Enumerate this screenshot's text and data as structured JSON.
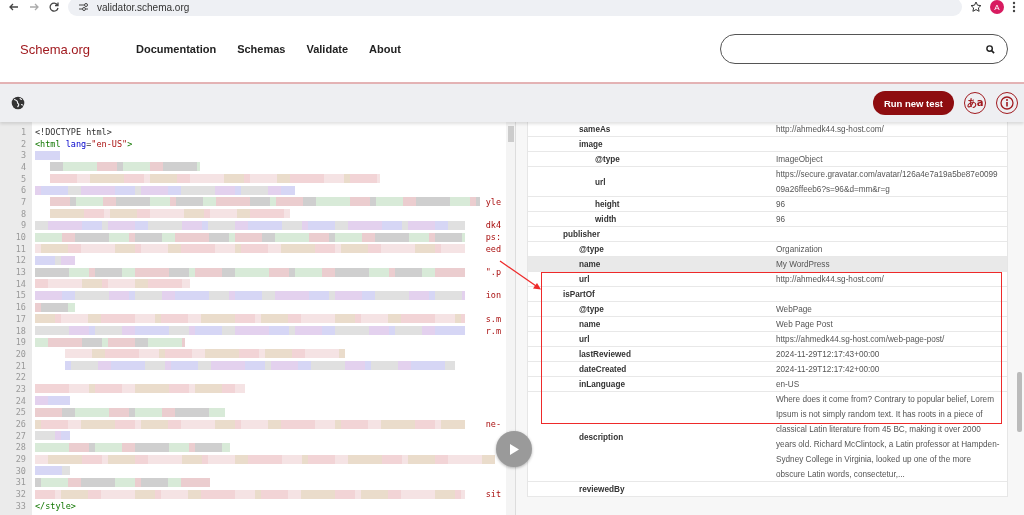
{
  "browser": {
    "url": "validator.schema.org",
    "avatar": "A"
  },
  "header": {
    "logo": "Schema.org",
    "nav": [
      {
        "label": "Documentation"
      },
      {
        "label": "Schemas"
      },
      {
        "label": "Validate"
      },
      {
        "label": "About"
      }
    ]
  },
  "toolbar": {
    "run_button": "Run new test",
    "language_button": "あa"
  },
  "editor": {
    "lines": [
      {
        "number": "1",
        "kind": "code",
        "tokens": [
          {
            "kind": "plain",
            "text": "<!DOCTYPE html>"
          }
        ]
      },
      {
        "number": "2",
        "kind": "code",
        "tokens": [
          {
            "kind": "tag",
            "text": "<html"
          },
          {
            "kind": "attr",
            "text": " lang"
          },
          {
            "kind": "plain",
            "text": "="
          },
          {
            "kind": "string",
            "text": "\"en-US\""
          },
          {
            "kind": "tag",
            "text": ">"
          }
        ]
      },
      {
        "number": "3",
        "kind": "blurred"
      },
      {
        "number": "4",
        "kind": "blurred"
      },
      {
        "number": "5",
        "kind": "blurred"
      },
      {
        "number": "6",
        "kind": "blurred"
      },
      {
        "number": "7",
        "kind": "blurred",
        "tail": "yle"
      },
      {
        "number": "8",
        "kind": "blurred"
      },
      {
        "number": "9",
        "kind": "blurred",
        "tail": "dk4"
      },
      {
        "number": "10",
        "kind": "blurred",
        "tail": "ps:"
      },
      {
        "number": "11",
        "kind": "blurred",
        "tail": "eed"
      },
      {
        "number": "12",
        "kind": "blurred"
      },
      {
        "number": "13",
        "kind": "blurred",
        "tail": "\".p"
      },
      {
        "number": "14",
        "kind": "blurred"
      },
      {
        "number": "15",
        "kind": "blurred",
        "tail": "ion"
      },
      {
        "number": "16",
        "kind": "blurred"
      },
      {
        "number": "17",
        "kind": "blurred",
        "tail": "s.m"
      },
      {
        "number": "18",
        "kind": "blurred",
        "tail": "r.m"
      },
      {
        "number": "19",
        "kind": "blurred"
      },
      {
        "number": "20",
        "kind": "blurred"
      },
      {
        "number": "21",
        "kind": "blurred"
      },
      {
        "number": "22",
        "kind": "blurred"
      },
      {
        "number": "23",
        "kind": "blurred"
      },
      {
        "number": "24",
        "kind": "blurred"
      },
      {
        "number": "25",
        "kind": "blurred"
      },
      {
        "number": "26",
        "kind": "blurred",
        "tail": "ne-"
      },
      {
        "number": "27",
        "kind": "blurred"
      },
      {
        "number": "28",
        "kind": "blurred"
      },
      {
        "number": "29",
        "kind": "blurred"
      },
      {
        "number": "30",
        "kind": "blurred"
      },
      {
        "number": "31",
        "kind": "blurred"
      },
      {
        "number": "32",
        "kind": "blurred",
        "tail": "sit"
      },
      {
        "number": "33",
        "kind": "code",
        "tokens": [
          {
            "kind": "tag",
            "text": "</style>"
          }
        ]
      }
    ]
  },
  "results": {
    "properties": [
      {
        "children": [
          {
            "key": "sameAs",
            "value": "http://ahmedk44.sg-host.com/",
            "selected": false
          },
          {
            "key": "image",
            "selected": false,
            "children": [
              {
                "key": "@type",
                "value": "ImageObject",
                "selected": false
              },
              {
                "key": "url",
                "value": "https://secure.gravatar.com/avatar/126a4e7a19a5be87e009909a26ffeeb6?s=96&d=mm&r=g",
                "selected": false
              },
              {
                "key": "height",
                "value": "96",
                "selected": false
              },
              {
                "key": "width",
                "value": "96",
                "selected": false
              }
            ]
          }
        ]
      },
      {
        "key": "publisher",
        "selected": false,
        "children": [
          {
            "key": "@type",
            "value": "Organization",
            "selected": false
          },
          {
            "key": "name",
            "value": "My WordPress",
            "selected": true
          },
          {
            "key": "url",
            "value": "http://ahmedk44.sg-host.com/",
            "selected": false
          }
        ]
      },
      {
        "key": "isPartOf",
        "selected": false,
        "children": [
          {
            "key": "@type",
            "value": "WebPage",
            "selected": false
          },
          {
            "key": "name",
            "value": "Web Page Post",
            "selected": false
          },
          {
            "key": "url",
            "value": "https://ahmedk44.sg-host.com/web-page-post/",
            "selected": false
          },
          {
            "key": "lastReviewed",
            "value": "2024-11-29T12:17:43+00:00",
            "selected": false
          },
          {
            "key": "dateCreated",
            "value": "2024-11-29T12:17:42+00:00",
            "selected": false
          },
          {
            "key": "inLanguage",
            "value": "en-US",
            "selected": false
          },
          {
            "key": "description",
            "value": "Where does it come from? Contrary to popular belief, Lorem Ipsum is not simply random text. It has roots in a piece of classical Latin literature from 45 BC, making it over 2000 years old. Richard McClintock, a Latin professor at Hampden-Sydney College in Virginia, looked up one of the more obscure Latin words, consectetur,...",
            "selected": false
          },
          {
            "key": "reviewedBy",
            "selected": false
          }
        ]
      }
    ]
  }
}
